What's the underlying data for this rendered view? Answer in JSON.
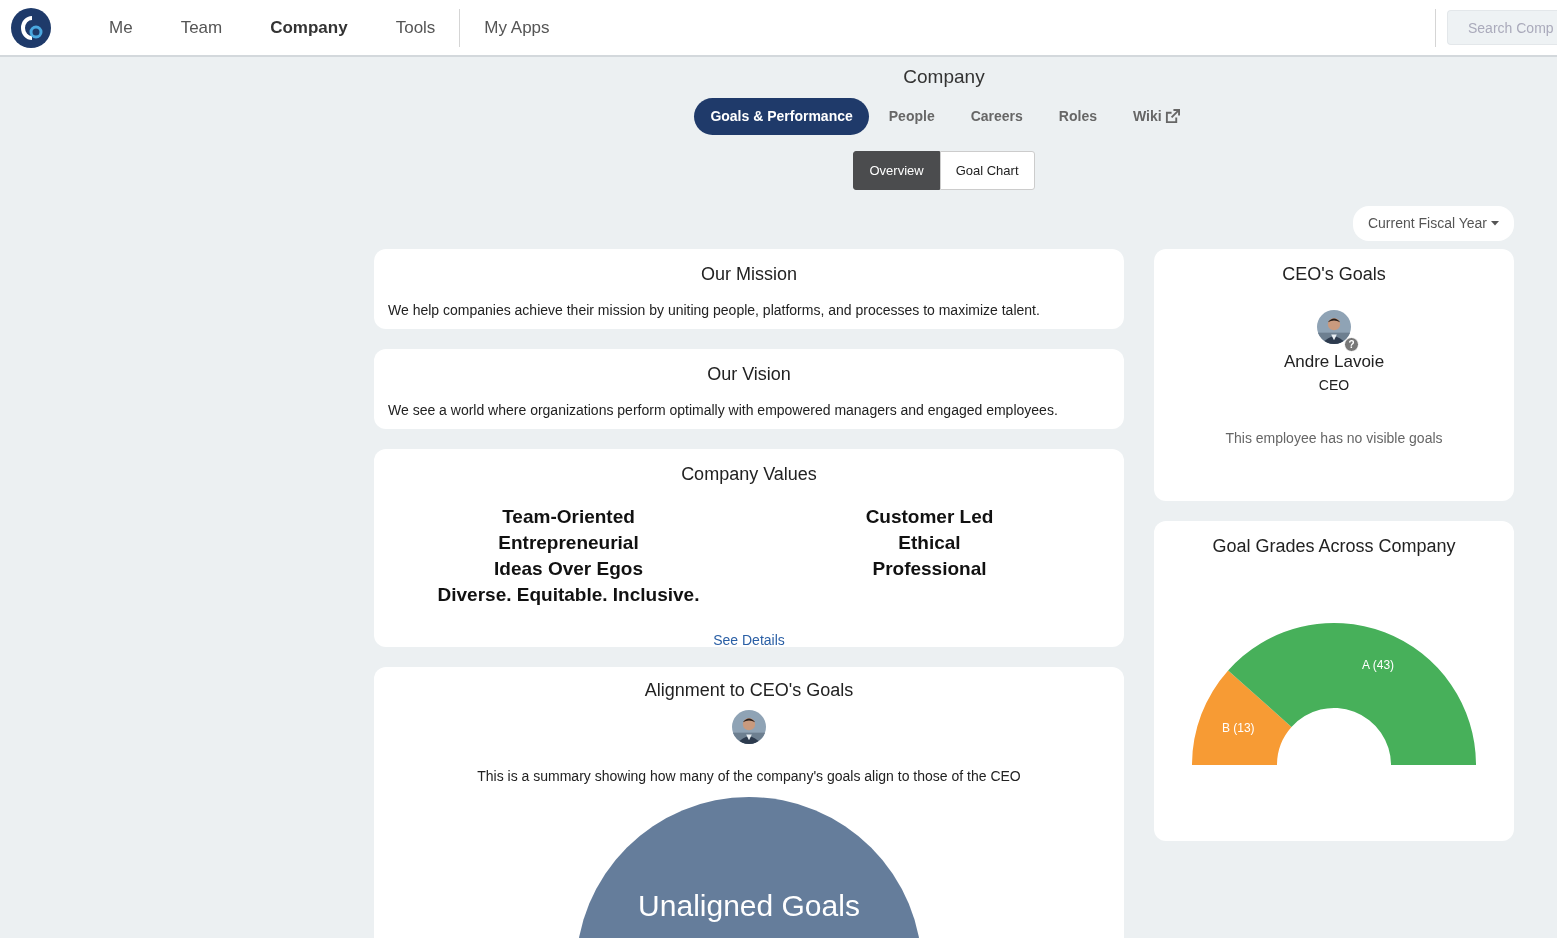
{
  "navbar": {
    "items": [
      {
        "label": "Me",
        "selected": false
      },
      {
        "label": "Team",
        "selected": false
      },
      {
        "label": "Company",
        "selected": true
      },
      {
        "label": "Tools",
        "selected": false
      }
    ],
    "apps_label": "My Apps",
    "search": {
      "placeholder": "Search Comp"
    }
  },
  "page_title": "Company",
  "tabs": [
    {
      "label": "Goals & Performance",
      "selected": true,
      "kind": "tab"
    },
    {
      "label": "People",
      "selected": false,
      "kind": "tab"
    },
    {
      "label": "Careers",
      "selected": false,
      "kind": "tab"
    },
    {
      "label": "Roles",
      "selected": false,
      "kind": "tab"
    },
    {
      "label": "Wiki",
      "selected": false,
      "kind": "external"
    }
  ],
  "subtabs": [
    {
      "label": "Overview",
      "selected": true
    },
    {
      "label": "Goal Chart",
      "selected": false
    }
  ],
  "period_dropdown": {
    "label": "Current Fiscal Year"
  },
  "mission": {
    "title": "Our Mission",
    "text": "We help companies achieve their mission by uniting people, platforms, and processes to maximize talent."
  },
  "vision": {
    "title": "Our Vision",
    "text": "We see a world where organizations perform optimally with empowered managers and engaged employees."
  },
  "company_values": {
    "title": "Company Values",
    "columns": [
      [
        "Team-Oriented",
        "Entrepreneurial",
        "Ideas Over Egos",
        "Diverse. Equitable. Inclusive."
      ],
      [
        "Customer Led",
        "Ethical",
        "Professional"
      ]
    ],
    "link": "See Details"
  },
  "alignment": {
    "title": "Alignment to CEO's Goals",
    "summary": "This is a summary showing how many of the company's goals align to those of the CEO",
    "bubble_label": "Unaligned Goals"
  },
  "ceo_goals": {
    "title": "CEO's Goals",
    "name": "Andre Lavoie",
    "role": "CEO",
    "badge": "?",
    "empty_text": "This employee has no visible goals"
  },
  "grades": {
    "title": "Goal Grades Across Company",
    "chart_data": {
      "type": "donut",
      "values": [
        13,
        43
      ],
      "colors": [
        "#f79b34",
        "#47b05a"
      ],
      "value_labels": [
        "B (13)",
        "A (43)"
      ]
    }
  }
}
